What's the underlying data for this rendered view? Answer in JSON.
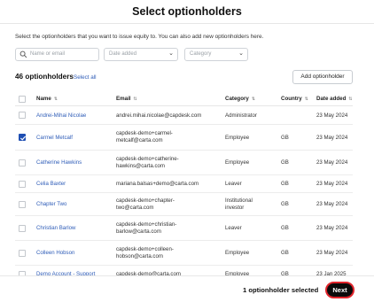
{
  "dialog": {
    "title": "Select optionholders",
    "intro": "Select the optionholders that you want to issue equity to. You can also add new optionholders here."
  },
  "filters": {
    "search_placeholder": "Name or email",
    "date_added_placeholder": "Date added",
    "category_placeholder": "Category"
  },
  "list": {
    "count_label": "46 optionholders",
    "select_all_label": "Select all",
    "add_button_label": "Add optionholder"
  },
  "table": {
    "columns": [
      "Name",
      "Email",
      "Category",
      "Country",
      "Date added"
    ],
    "rows": [
      {
        "name": "Andrei-Mihai Nicolae",
        "email": "andrei.mihai.nicolae@capdesk.com",
        "category": "Administrator",
        "country": "",
        "date": "23 May 2024",
        "checked": false
      },
      {
        "name": "Carmel Metcalf",
        "email": "capdesk-demo+carmel-metcalf@carta.com",
        "category": "Employee",
        "country": "GB",
        "date": "23 May 2024",
        "checked": true
      },
      {
        "name": "Catherine Hawkins",
        "email": "capdesk-demo+catherine-hawkins@carta.com",
        "category": "Employee",
        "country": "GB",
        "date": "23 May 2024",
        "checked": false
      },
      {
        "name": "Celia Baxter",
        "email": "mariana.balsas+demo@carta.com",
        "category": "Leaver",
        "country": "GB",
        "date": "23 May 2024",
        "checked": false
      },
      {
        "name": "Chapter Two",
        "email": "capdesk-demo+chapter-two@carta.com",
        "category": "Institutional investor",
        "country": "GB",
        "date": "23 May 2024",
        "checked": false
      },
      {
        "name": "Christian Barlow",
        "email": "capdesk-demo+christian-barlow@carta.com",
        "category": "Leaver",
        "country": "GB",
        "date": "23 May 2024",
        "checked": false
      },
      {
        "name": "Colleen Hobson",
        "email": "capdesk-demo+colleen-hobson@carta.com",
        "category": "Employee",
        "country": "GB",
        "date": "23 May 2024",
        "checked": false
      },
      {
        "name": "Demo Account - Support",
        "email": "capdesk-demo@carta.com",
        "category": "Employee",
        "country": "GB",
        "date": "23 Jan 2025",
        "checked": false
      }
    ]
  },
  "footer": {
    "selected_label": "1 optionholder selected",
    "next_label": "Next"
  },
  "colors": {
    "link": "#2f5db8",
    "checkbox_checked": "#1f4fb3",
    "next_button_bg": "#0b0b0b",
    "next_button_outline": "#e0242b"
  }
}
